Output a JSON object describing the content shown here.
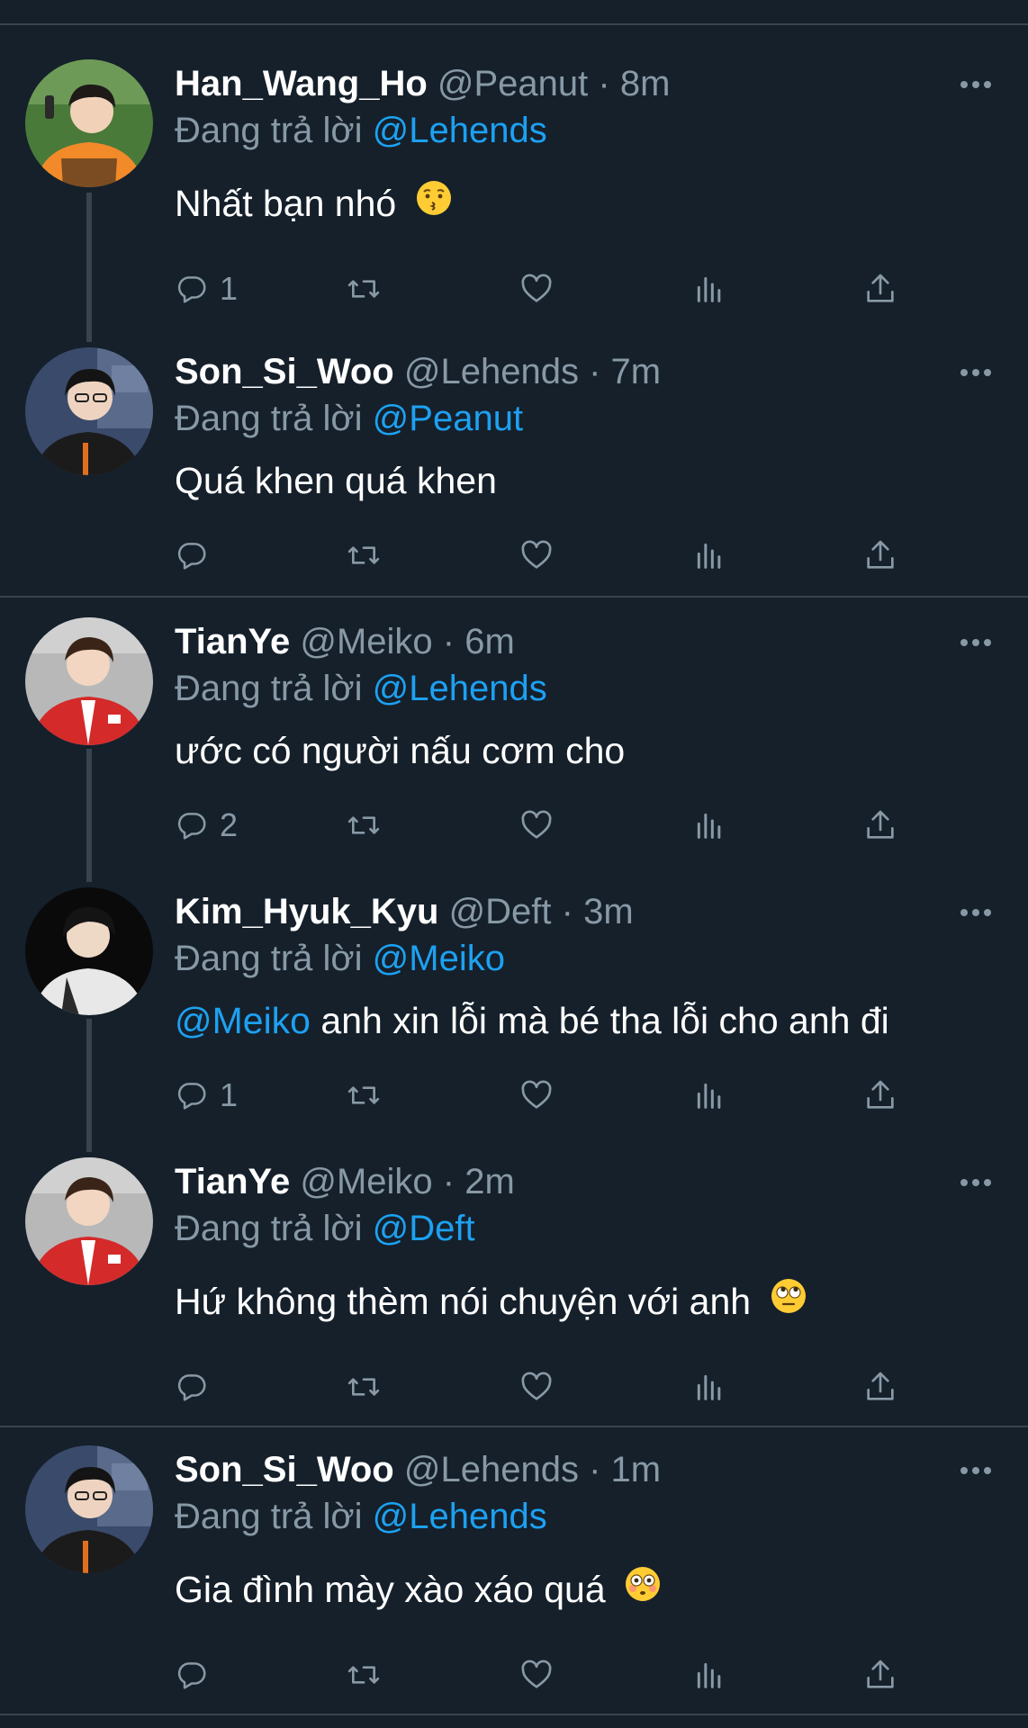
{
  "tweets": [
    {
      "name": "Han_Wang_Ho",
      "handle": "@Peanut",
      "sep": "·",
      "time": "8m",
      "replying_prefix": "Đang trả lời",
      "replying_to": "@Lehends",
      "body": "Nhất bạn nhó",
      "body_emoji": "kissing-face",
      "reply_count": "1",
      "avatar": {
        "shirt": "#f28a2a",
        "bg": "#4a7a3a",
        "accent": "#1a1a1a"
      }
    },
    {
      "name": "Son_Si_Woo",
      "handle": "@Lehends",
      "sep": "·",
      "time": "7m",
      "replying_prefix": "Đang trả lời",
      "replying_to": "@Peanut",
      "body": "Quá khen quá khen",
      "reply_count": "",
      "avatar": {
        "shirt": "#1b1b1b",
        "bg": "#3a4a6a",
        "accent": "#e07020"
      }
    },
    {
      "name": "TianYe",
      "handle": "@Meiko",
      "sep": "·",
      "time": "6m",
      "replying_prefix": "Đang trả lời",
      "replying_to": "@Lehends",
      "body": "ước có người nấu cơm cho",
      "reply_count": "2",
      "avatar": {
        "shirt": "#d42a2a",
        "bg": "#b8b8b8",
        "accent": "#ffffff"
      }
    },
    {
      "name": "Kim_Hyuk_Kyu",
      "handle": "@Deft",
      "sep": "·",
      "time": "3m",
      "replying_prefix": "Đang trả lời",
      "replying_to": "@Meiko",
      "body_mention": "@Meiko",
      "body": " anh xin lỗi mà bé tha lỗi cho anh đi",
      "reply_count": "1",
      "avatar": {
        "shirt": "#e8e8e8",
        "bg": "#0a0a0a",
        "accent": "#2a2a2a"
      }
    },
    {
      "name": "TianYe",
      "handle": "@Meiko",
      "sep": "·",
      "time": "2m",
      "replying_prefix": "Đang trả lời",
      "replying_to": "@Deft",
      "body": "Hứ không thèm nói chuyện với anh",
      "body_emoji": "rolling-eyes-face",
      "reply_count": "",
      "avatar": {
        "shirt": "#d42a2a",
        "bg": "#b8b8b8",
        "accent": "#ffffff"
      }
    },
    {
      "name": "Son_Si_Woo",
      "handle": "@Lehends",
      "sep": "·",
      "time": "1m",
      "replying_prefix": "Đang trả lời",
      "replying_to": "@Lehends",
      "body": "Gia đình mày xào xáo quá",
      "body_emoji": "flushed-face",
      "reply_count": "",
      "avatar": {
        "shirt": "#1b1b1b",
        "bg": "#3a4a6a",
        "accent": "#e07020"
      }
    }
  ],
  "colors": {
    "background": "#15202b",
    "divider": "#38444d",
    "secondary_text": "#8899a6",
    "link": "#1da1f2",
    "primary_text": "#ffffff"
  },
  "icons": [
    "reply-icon",
    "retweet-icon",
    "like-icon",
    "analytics-icon",
    "share-icon",
    "more-icon"
  ]
}
